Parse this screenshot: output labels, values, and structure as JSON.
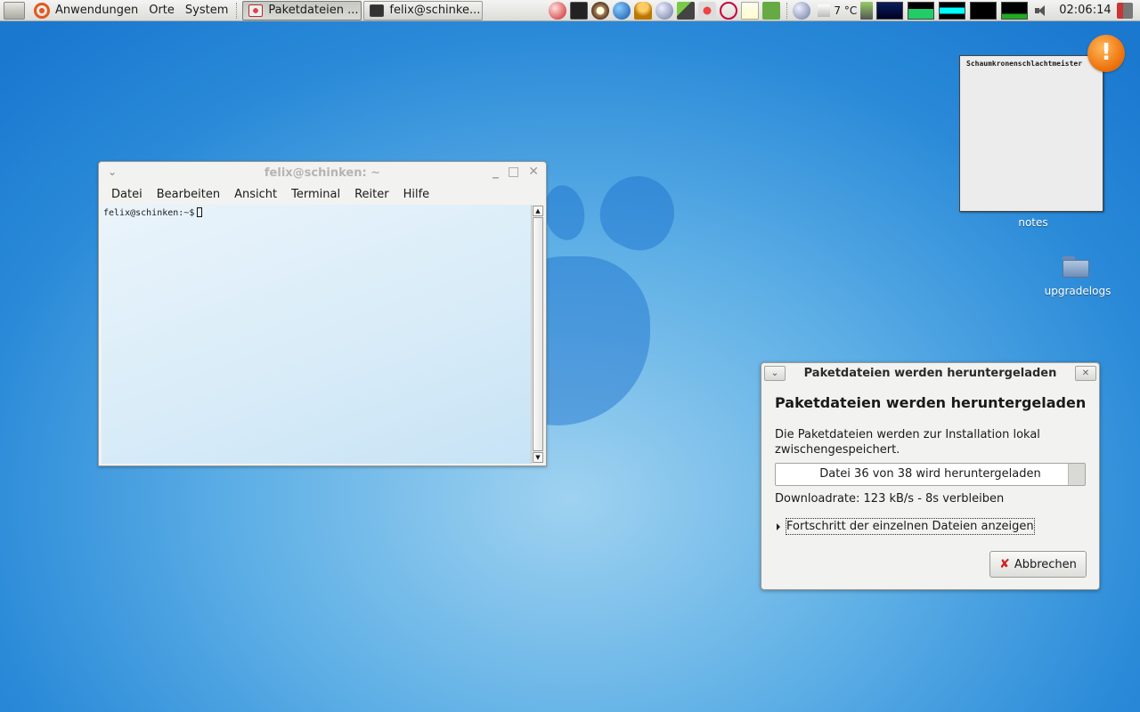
{
  "panel": {
    "menus": [
      "Anwendungen",
      "Orte",
      "System"
    ],
    "tasks": [
      {
        "label": "Paketdateien ...",
        "icon": "package-icon"
      },
      {
        "label": "felix@schinke...",
        "icon": "terminal-icon"
      }
    ],
    "tray_icons": [
      "network-disconnected-icon",
      "terminal-icon",
      "compass-icon",
      "globe-icon",
      "user-icon",
      "satellite-icon",
      "pen-icon",
      "package-icon",
      "debian-icon",
      "notes-icon",
      "recycle-icon",
      "update-icon"
    ],
    "temperature": "7 °C",
    "clock": "02:06:14"
  },
  "terminal": {
    "title": "felix@schinken: ~",
    "menu": [
      "Datei",
      "Bearbeiten",
      "Ansicht",
      "Terminal",
      "Reiter",
      "Hilfe"
    ],
    "prompt": "felix@schinken:~$"
  },
  "desktop": {
    "notes_content": "Schaumkronenschlachtmeister",
    "notes_label": "notes",
    "folder_label": "upgradelogs",
    "alert_symbol": "!"
  },
  "dialog": {
    "title": "Paketdateien werden heruntergeladen",
    "heading": "Paketdateien werden heruntergeladen",
    "description": "Die Paketdateien werden zur Installation lokal zwischengespeichert.",
    "progress_text": "Datei 36 von 38 wird heruntergeladen",
    "progress_fraction": 0.947,
    "rate": "Downloadrate: 123 kB/s - 8s verbleiben",
    "expander_label": "Fortschritt der einzelnen Dateien anzeigen",
    "cancel_label": "Abbrechen"
  },
  "colors": {
    "accent": "#e2581d",
    "alert": "#ef7712",
    "desktop": "#2a8ad8"
  }
}
